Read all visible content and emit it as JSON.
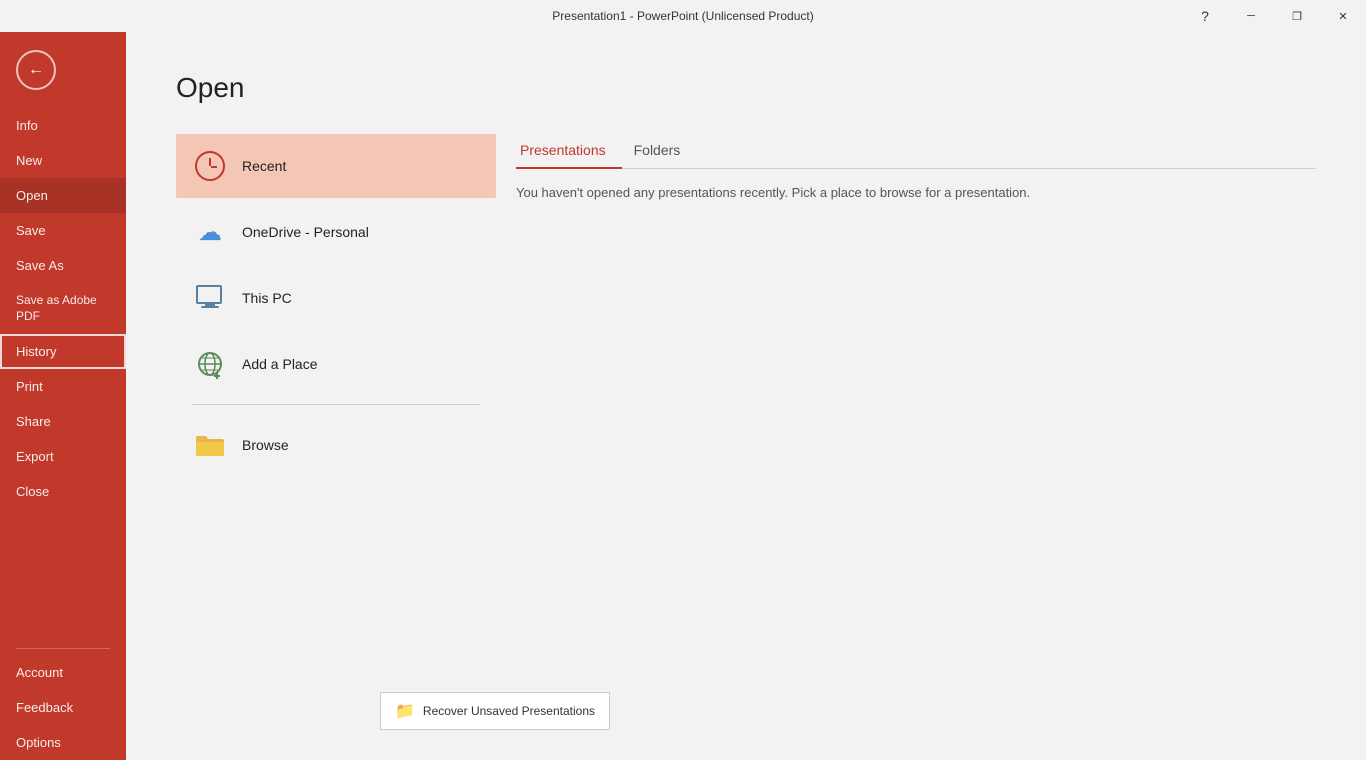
{
  "titlebar": {
    "title": "Presentation1 - PowerPoint (Unlicensed Product)",
    "help_icon": "?",
    "minimize_icon": "─",
    "maximize_icon": "❒",
    "close_icon": "✕"
  },
  "sidebar": {
    "back_icon": "←",
    "items": [
      {
        "id": "info",
        "label": "Info",
        "state": "normal"
      },
      {
        "id": "new",
        "label": "New",
        "state": "normal"
      },
      {
        "id": "open",
        "label": "Open",
        "state": "active"
      },
      {
        "id": "save",
        "label": "Save",
        "state": "normal"
      },
      {
        "id": "save-as",
        "label": "Save As",
        "state": "normal"
      },
      {
        "id": "save-adobe",
        "label": "Save as Adobe PDF",
        "state": "normal"
      },
      {
        "id": "history",
        "label": "History",
        "state": "highlighted"
      },
      {
        "id": "print",
        "label": "Print",
        "state": "normal"
      },
      {
        "id": "share",
        "label": "Share",
        "state": "normal"
      },
      {
        "id": "export",
        "label": "Export",
        "state": "normal"
      },
      {
        "id": "close",
        "label": "Close",
        "state": "normal"
      }
    ],
    "bottom_items": [
      {
        "id": "account",
        "label": "Account"
      },
      {
        "id": "feedback",
        "label": "Feedback"
      },
      {
        "id": "options",
        "label": "Options"
      }
    ]
  },
  "main": {
    "page_title": "Open",
    "locations": [
      {
        "id": "recent",
        "label": "Recent",
        "icon": "clock",
        "selected": true
      },
      {
        "id": "onedrive",
        "label": "OneDrive - Personal",
        "icon": "onedrive"
      },
      {
        "id": "this-pc",
        "label": "This PC",
        "icon": "pc"
      },
      {
        "id": "add-place",
        "label": "Add a Place",
        "icon": "globe"
      },
      {
        "id": "browse",
        "label": "Browse",
        "icon": "folder"
      }
    ],
    "tabs": [
      {
        "id": "presentations",
        "label": "Presentations",
        "active": true
      },
      {
        "id": "folders",
        "label": "Folders",
        "active": false
      }
    ],
    "empty_message": "You haven't opened any presentations recently. Pick a place to browse for a presentation.",
    "recover_button_label": "Recover Unsaved Presentations"
  }
}
